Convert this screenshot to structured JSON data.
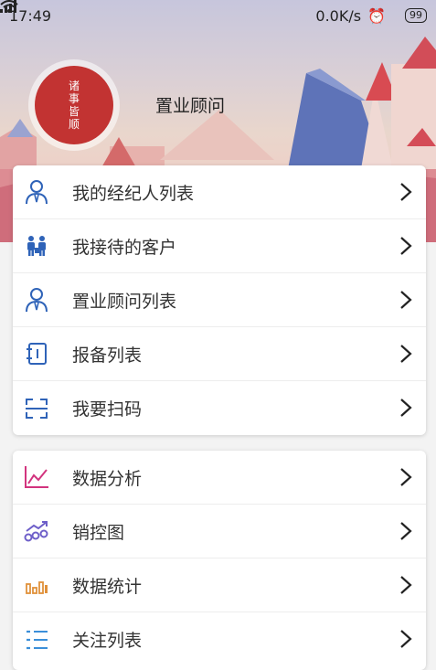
{
  "status": {
    "time": "17:49",
    "speed": "0.0K/s",
    "battery": "99"
  },
  "profile": {
    "avatar_lines": [
      "诸",
      "事",
      "皆",
      "顺"
    ],
    "role": "置业顾问"
  },
  "menu1": [
    {
      "label": "我的经纪人列表",
      "icon": "agent-icon"
    },
    {
      "label": "我接待的客户",
      "icon": "customers-icon"
    },
    {
      "label": "置业顾问列表",
      "icon": "consultant-icon"
    },
    {
      "label": "报备列表",
      "icon": "report-icon"
    },
    {
      "label": "我要扫码",
      "icon": "scan-icon"
    }
  ],
  "menu2": [
    {
      "label": "数据分析",
      "icon": "line-chart-icon"
    },
    {
      "label": "销控图",
      "icon": "trend-chart-icon"
    },
    {
      "label": "数据统计",
      "icon": "bar-stats-icon"
    },
    {
      "label": "关注列表",
      "icon": "list-icon"
    }
  ],
  "colors": {
    "avatar": "#c23332",
    "icon_blue": "#2f63b8",
    "icon_pink": "#d2347e",
    "icon_purple": "#6e5fc9",
    "icon_orange": "#e0913b",
    "icon_sky": "#3b8fd9"
  }
}
